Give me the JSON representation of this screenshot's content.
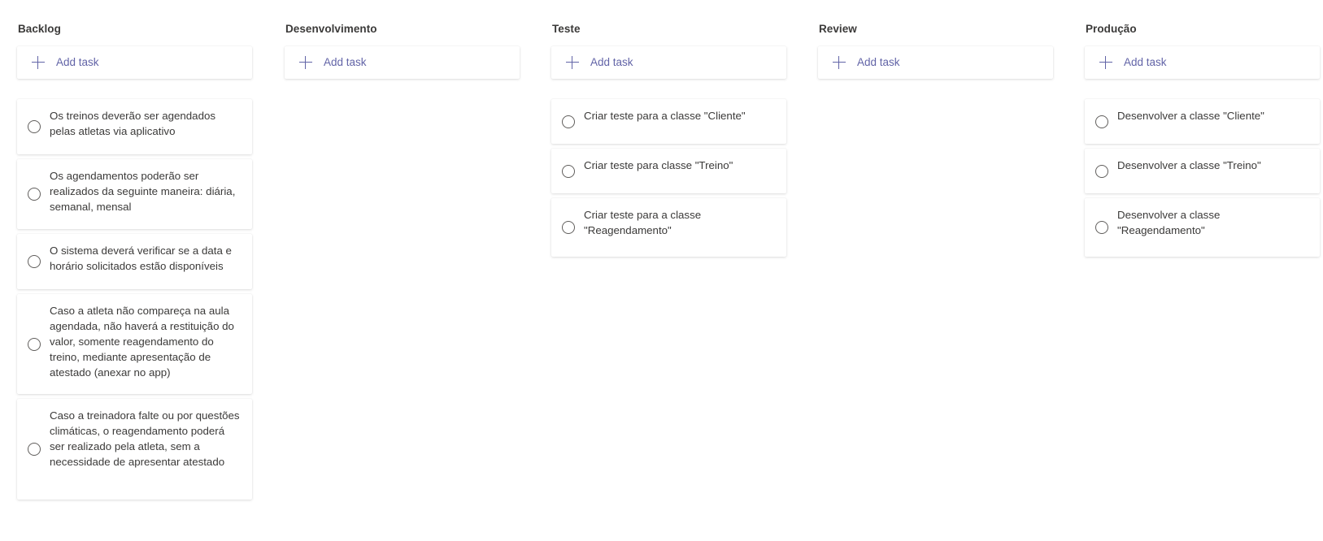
{
  "add_task_label": "Add task",
  "columns": [
    {
      "title": "Backlog",
      "tasks": [
        "Os treinos deverão ser agendados pelas atletas via aplicativo",
        "Os agendamentos poderão ser realizados da seguinte maneira: diária, semanal, mensal",
        "O sistema deverá verificar se a data e horário solicitados estão disponíveis",
        "Caso a atleta não compareça na aula agendada, não haverá a restituição do valor, somente reagendamento do treino, mediante apresentação de atestado (anexar no app)",
        "Caso a treinadora falte ou por questões climáticas, o reagendamento poderá ser realizado pela atleta, sem a necessidade de apresentar atestado"
      ]
    },
    {
      "title": "Desenvolvimento",
      "tasks": []
    },
    {
      "title": "Teste",
      "tasks": [
        "Criar teste para a classe \"Cliente\"",
        "Criar teste para classe \"Treino\"",
        "Criar teste para a classe \"Reagendamento\""
      ]
    },
    {
      "title": "Review",
      "tasks": []
    },
    {
      "title": "Produção",
      "tasks": [
        "Desenvolver a classe \"Cliente\"",
        "Desenvolver a classe \"Treino\"",
        "Desenvolver a classe \"Reagendamento\""
      ]
    }
  ],
  "colors": {
    "accent": "#6264a7",
    "text": "#3b3a39",
    "background": "#ffffff"
  },
  "icons": {
    "add": "plus-icon",
    "task_status": "circle-icon"
  }
}
